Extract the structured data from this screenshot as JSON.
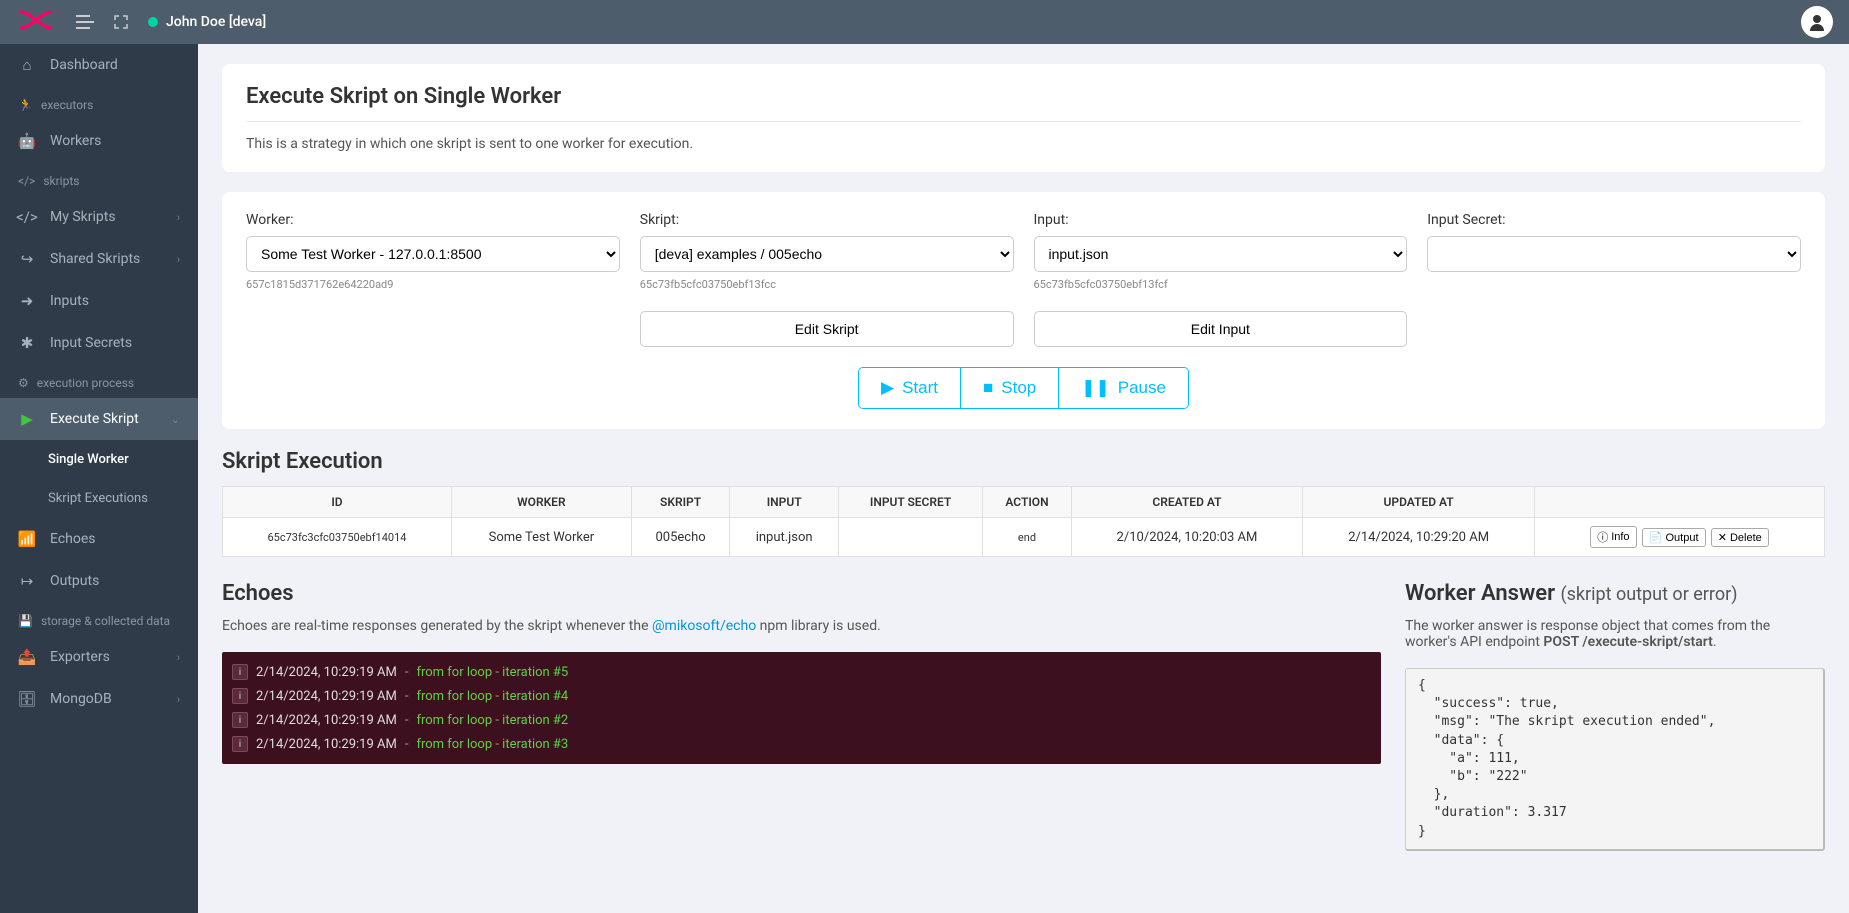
{
  "user": {
    "name": "John Doe [deva]"
  },
  "sidebar": {
    "dashboard": "Dashboard",
    "sec_executors": "executors",
    "workers": "Workers",
    "sec_skripts": "skripts",
    "my_skripts": "My Skripts",
    "shared_skripts": "Shared Skripts",
    "inputs": "Inputs",
    "input_secrets": "Input Secrets",
    "sec_execution": "execution process",
    "execute_skript": "Execute Skript",
    "single_worker": "Single Worker",
    "skript_executions": "Skript Executions",
    "echoes": "Echoes",
    "outputs": "Outputs",
    "sec_storage": "storage & collected data",
    "exporters": "Exporters",
    "mongodb": "MongoDB"
  },
  "page": {
    "title": "Execute Skript on Single Worker",
    "description": "This is a strategy in which one skript is sent to one worker for execution."
  },
  "form": {
    "worker": {
      "label": "Worker:",
      "value": "Some Test Worker - 127.0.0.1:8500",
      "hint": "657c1815d371762e64220ad9"
    },
    "skript": {
      "label": "Skript:",
      "value": "[deva] examples / 005echo",
      "hint": "65c73fb5cfc03750ebf13fcc"
    },
    "input": {
      "label": "Input:",
      "value": "input.json",
      "hint": "65c73fb5cfc03750ebf13fcf"
    },
    "input_secret": {
      "label": "Input Secret:",
      "value": ""
    },
    "edit_skript": "Edit Skript",
    "edit_input": "Edit Input",
    "start": "Start",
    "stop": "Stop",
    "pause": "Pause"
  },
  "table": {
    "title": "Skript Execution",
    "headers": [
      "ID",
      "WORKER",
      "SKRIPT",
      "INPUT",
      "INPUT SECRET",
      "ACTION",
      "CREATED AT",
      "UPDATED AT",
      ""
    ],
    "row": {
      "id": "65c73fc3cfc03750ebf14014",
      "worker": "Some Test Worker",
      "skript": "005echo",
      "input": "input.json",
      "input_secret": "",
      "action": "end",
      "created": "2/10/2024, 10:20:03 AM",
      "updated": "2/14/2024, 10:29:20 AM",
      "btn_info": "Info",
      "btn_output": "Output",
      "btn_delete": "Delete"
    }
  },
  "echoes": {
    "title": "Echoes",
    "desc1": "Echoes are real-time responses generated by the skript whenever the ",
    "link": "@mikosoft/echo",
    "desc2": " npm library is used.",
    "lines": [
      {
        "time": "2/14/2024, 10:29:19 AM",
        "msg": "from for loop - iteration #5"
      },
      {
        "time": "2/14/2024, 10:29:19 AM",
        "msg": "from for loop - iteration #4"
      },
      {
        "time": "2/14/2024, 10:29:19 AM",
        "msg": "from for loop - iteration #2"
      },
      {
        "time": "2/14/2024, 10:29:19 AM",
        "msg": "from for loop - iteration #3"
      }
    ]
  },
  "answer": {
    "title": "Worker Answer ",
    "subtitle": "(skript output or error)",
    "desc1": "The worker answer is response object that comes from the worker's API endpoint ",
    "endpoint": "POST /execute-skript/start",
    "desc2": ".",
    "json": "{\n  \"success\": true,\n  \"msg\": \"The skript execution ended\",\n  \"data\": {\n    \"a\": 111,\n    \"b\": \"222\"\n  },\n  \"duration\": 3.317\n}"
  }
}
